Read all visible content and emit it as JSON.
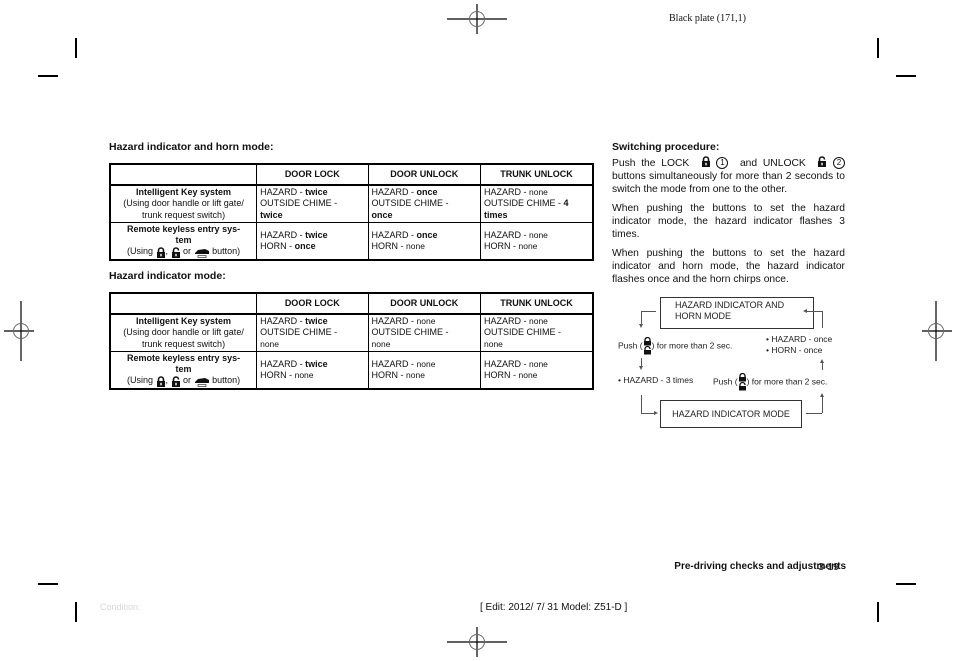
{
  "header": {
    "plate": "Black plate (171,1)"
  },
  "table1": {
    "title": "Hazard indicator and horn mode:",
    "columns": [
      "",
      "DOOR LOCK",
      "DOOR UNLOCK",
      "TRUNK UNLOCK"
    ],
    "rows": [
      {
        "head_title": "Intelligent Key system",
        "head_sub1": "(Using door handle or lift gate/",
        "head_sub2": "trunk request switch)",
        "cells": [
          {
            "l1": "HAZARD - ",
            "v1": "twice",
            "v1_bold": true,
            "l2": "OUTSIDE CHIME -",
            "v2": "twice",
            "v2_bold": true
          },
          {
            "l1": "HAZARD - ",
            "v1": "once",
            "v1_bold": true,
            "l2": "OUTSIDE CHIME -",
            "v2": "once",
            "v2_bold": true
          },
          {
            "l1": "HAZARD - ",
            "v1": "none",
            "v1_bold": false,
            "l2": "OUTSIDE CHIME - ",
            "l2_val": "4",
            "v2": "times",
            "v2_bold": true
          }
        ]
      },
      {
        "head_title1": "Remote keyless entry sys-",
        "head_title2": "tem",
        "head_using": "(Using",
        "head_sep": ",",
        "head_or": "or",
        "head_button": "button)",
        "cells": [
          {
            "l1": "HAZARD - ",
            "v1": "twice",
            "l2": "HORN - ",
            "v2": "once"
          },
          {
            "l1": "HAZARD - ",
            "v1": "once",
            "l2": "HORN - ",
            "v2": "none"
          },
          {
            "l1": "HAZARD - ",
            "v1": "none",
            "l2": "HORN - ",
            "v2": "none"
          }
        ]
      }
    ]
  },
  "table2": {
    "title": "Hazard indicator mode:",
    "columns": [
      "",
      "DOOR LOCK",
      "DOOR UNLOCK",
      "TRUNK UNLOCK"
    ],
    "rows": [
      {
        "head_title": "Intelligent Key system",
        "head_sub1": "(Using door handle or lift gate/",
        "head_sub2": "trunk request switch)",
        "cells": [
          {
            "l1": "HAZARD - ",
            "v1": "twice",
            "l2": "OUTSIDE CHIME -",
            "v2": "none"
          },
          {
            "l1": "HAZARD - ",
            "v1": "none",
            "l2": "OUTSIDE CHIME -",
            "v2": "none"
          },
          {
            "l1": "HAZARD - ",
            "v1": "none",
            "l2": "OUTSIDE CHIME -",
            "v2": "none"
          }
        ]
      },
      {
        "head_title1": "Remote keyless entry sys-",
        "head_title2": "tem",
        "head_using": "(Using",
        "head_sep": ",",
        "head_or": "or",
        "head_button": "button)",
        "cells": [
          {
            "l1": "HAZARD - ",
            "v1": "twice",
            "l2": "HORN - ",
            "v2": "none"
          },
          {
            "l1": "HAZARD - ",
            "v1": "none",
            "l2": "HORN - ",
            "v2": "none"
          },
          {
            "l1": "HAZARD - ",
            "v1": "none",
            "l2": "HORN - ",
            "v2": "none"
          }
        ]
      }
    ]
  },
  "procedure": {
    "title": "Switching procedure:",
    "p1_a": "Push the LOCK",
    "p1_n1": "1",
    "p1_b": "and UNLOCK",
    "p1_n2": "2",
    "p1_c": "buttons simultaneously for more than 2 seconds to switch the mode from one to the other.",
    "p2": "When pushing the buttons to set the hazard indicator mode, the hazard indicator flashes 3 times.",
    "p3": "When pushing the buttons to set the hazard indicator and horn mode, the hazard indicator flashes once and the horn chirps once."
  },
  "diagram": {
    "box_top_line1": "HAZARD INDICATOR AND",
    "box_top_line2": "HORN MODE",
    "box_bottom": "HAZARD INDICATOR MODE",
    "push_left_a": "Push (",
    "push_left_b": ") for more than 2 sec.",
    "push_right_a": "Push (",
    "push_right_b": ") for more than 2 sec.",
    "hazard_3": "• HAZARD - 3 times",
    "hazard_once": "• HAZARD - once",
    "horn_once": "• HORN - once"
  },
  "footer": {
    "section": "Pre-driving checks and adjustments",
    "page": "3-19",
    "condition": "Condition:",
    "edit": "[ Edit: 2012/ 7/ 31   Model:  Z51-D ]"
  }
}
